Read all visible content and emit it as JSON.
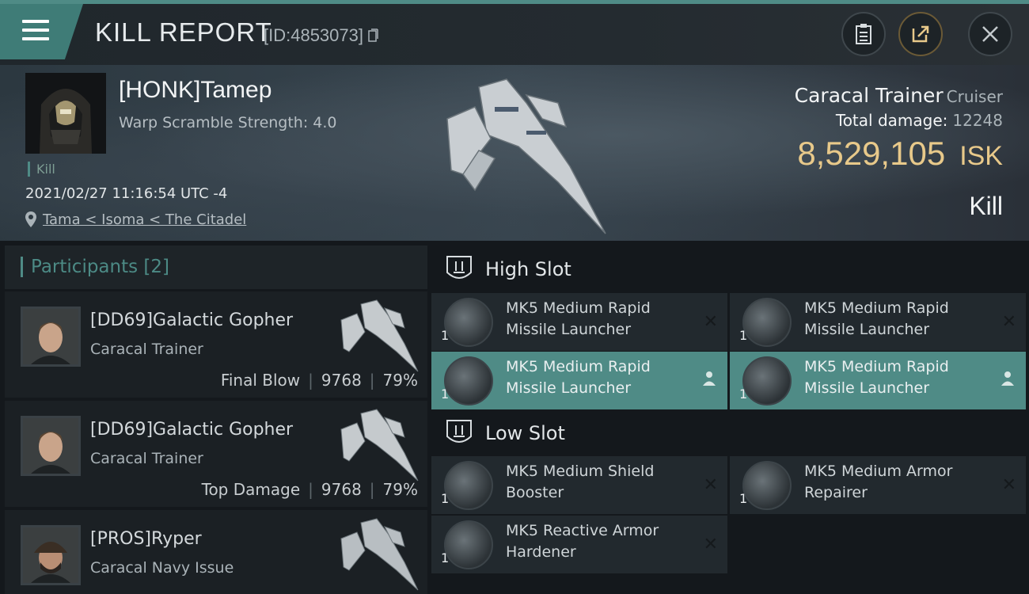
{
  "header": {
    "title": "KILL REPORT",
    "report_id": "[ID:4853073]",
    "buttons": [
      "clipboard-icon",
      "share-icon",
      "close-icon"
    ]
  },
  "victim": {
    "name": "[HONK]Tamep",
    "warp_scramble": "Warp Scramble Strength: 4.0",
    "tag": "Kill",
    "timestamp": "2021/02/27 11:16:54 UTC -4",
    "location": "Tama < Isoma < The Citadel",
    "ship_name": "Caracal Trainer",
    "ship_class": "Cruiser",
    "damage_label": "Total damage:",
    "damage_value": "12248",
    "isk_value": "8,529,105",
    "isk_unit": "ISK",
    "status": "Kill"
  },
  "participants": {
    "title": "Participants",
    "count": "[2]",
    "rows": [
      {
        "name": "[DD69]Galactic Gopher",
        "ship": "Caracal Trainer",
        "role": "Final Blow",
        "damage": "9768",
        "percent": "79%"
      },
      {
        "name": "[DD69]Galactic Gopher",
        "ship": "Caracal Trainer",
        "role": "Top Damage",
        "damage": "9768",
        "percent": "79%"
      },
      {
        "name": "[PROS]Ryper",
        "ship": "Caracal Navy Issue",
        "role": "",
        "damage": "",
        "percent": ""
      }
    ]
  },
  "slots": {
    "high": {
      "label": "High Slot",
      "items": [
        {
          "line1": "MK5 Medium Rapid",
          "line2": "Missile Launcher",
          "qty": "1",
          "state": "destroyed"
        },
        {
          "line1": "MK5 Medium Rapid",
          "line2": "Missile Launcher",
          "qty": "1",
          "state": "destroyed"
        },
        {
          "line1": "MK5 Medium Rapid",
          "line2": "Missile Launcher",
          "qty": "1",
          "state": "dropped"
        },
        {
          "line1": "MK5 Medium Rapid",
          "line2": "Missile Launcher",
          "qty": "1",
          "state": "dropped"
        }
      ]
    },
    "low": {
      "label": "Low Slot",
      "items": [
        {
          "line1": "MK5 Medium Shield",
          "line2": "Booster",
          "qty": "1",
          "state": "destroyed"
        },
        {
          "line1": "MK5 Medium Armor",
          "line2": "Repairer",
          "qty": "1",
          "state": "destroyed"
        },
        {
          "line1": "MK5 Reactive Armor",
          "line2": "Hardener",
          "qty": "1",
          "state": "destroyed"
        }
      ]
    }
  },
  "colors": {
    "accent": "#4f8b86",
    "isk": "#e8c98a"
  }
}
